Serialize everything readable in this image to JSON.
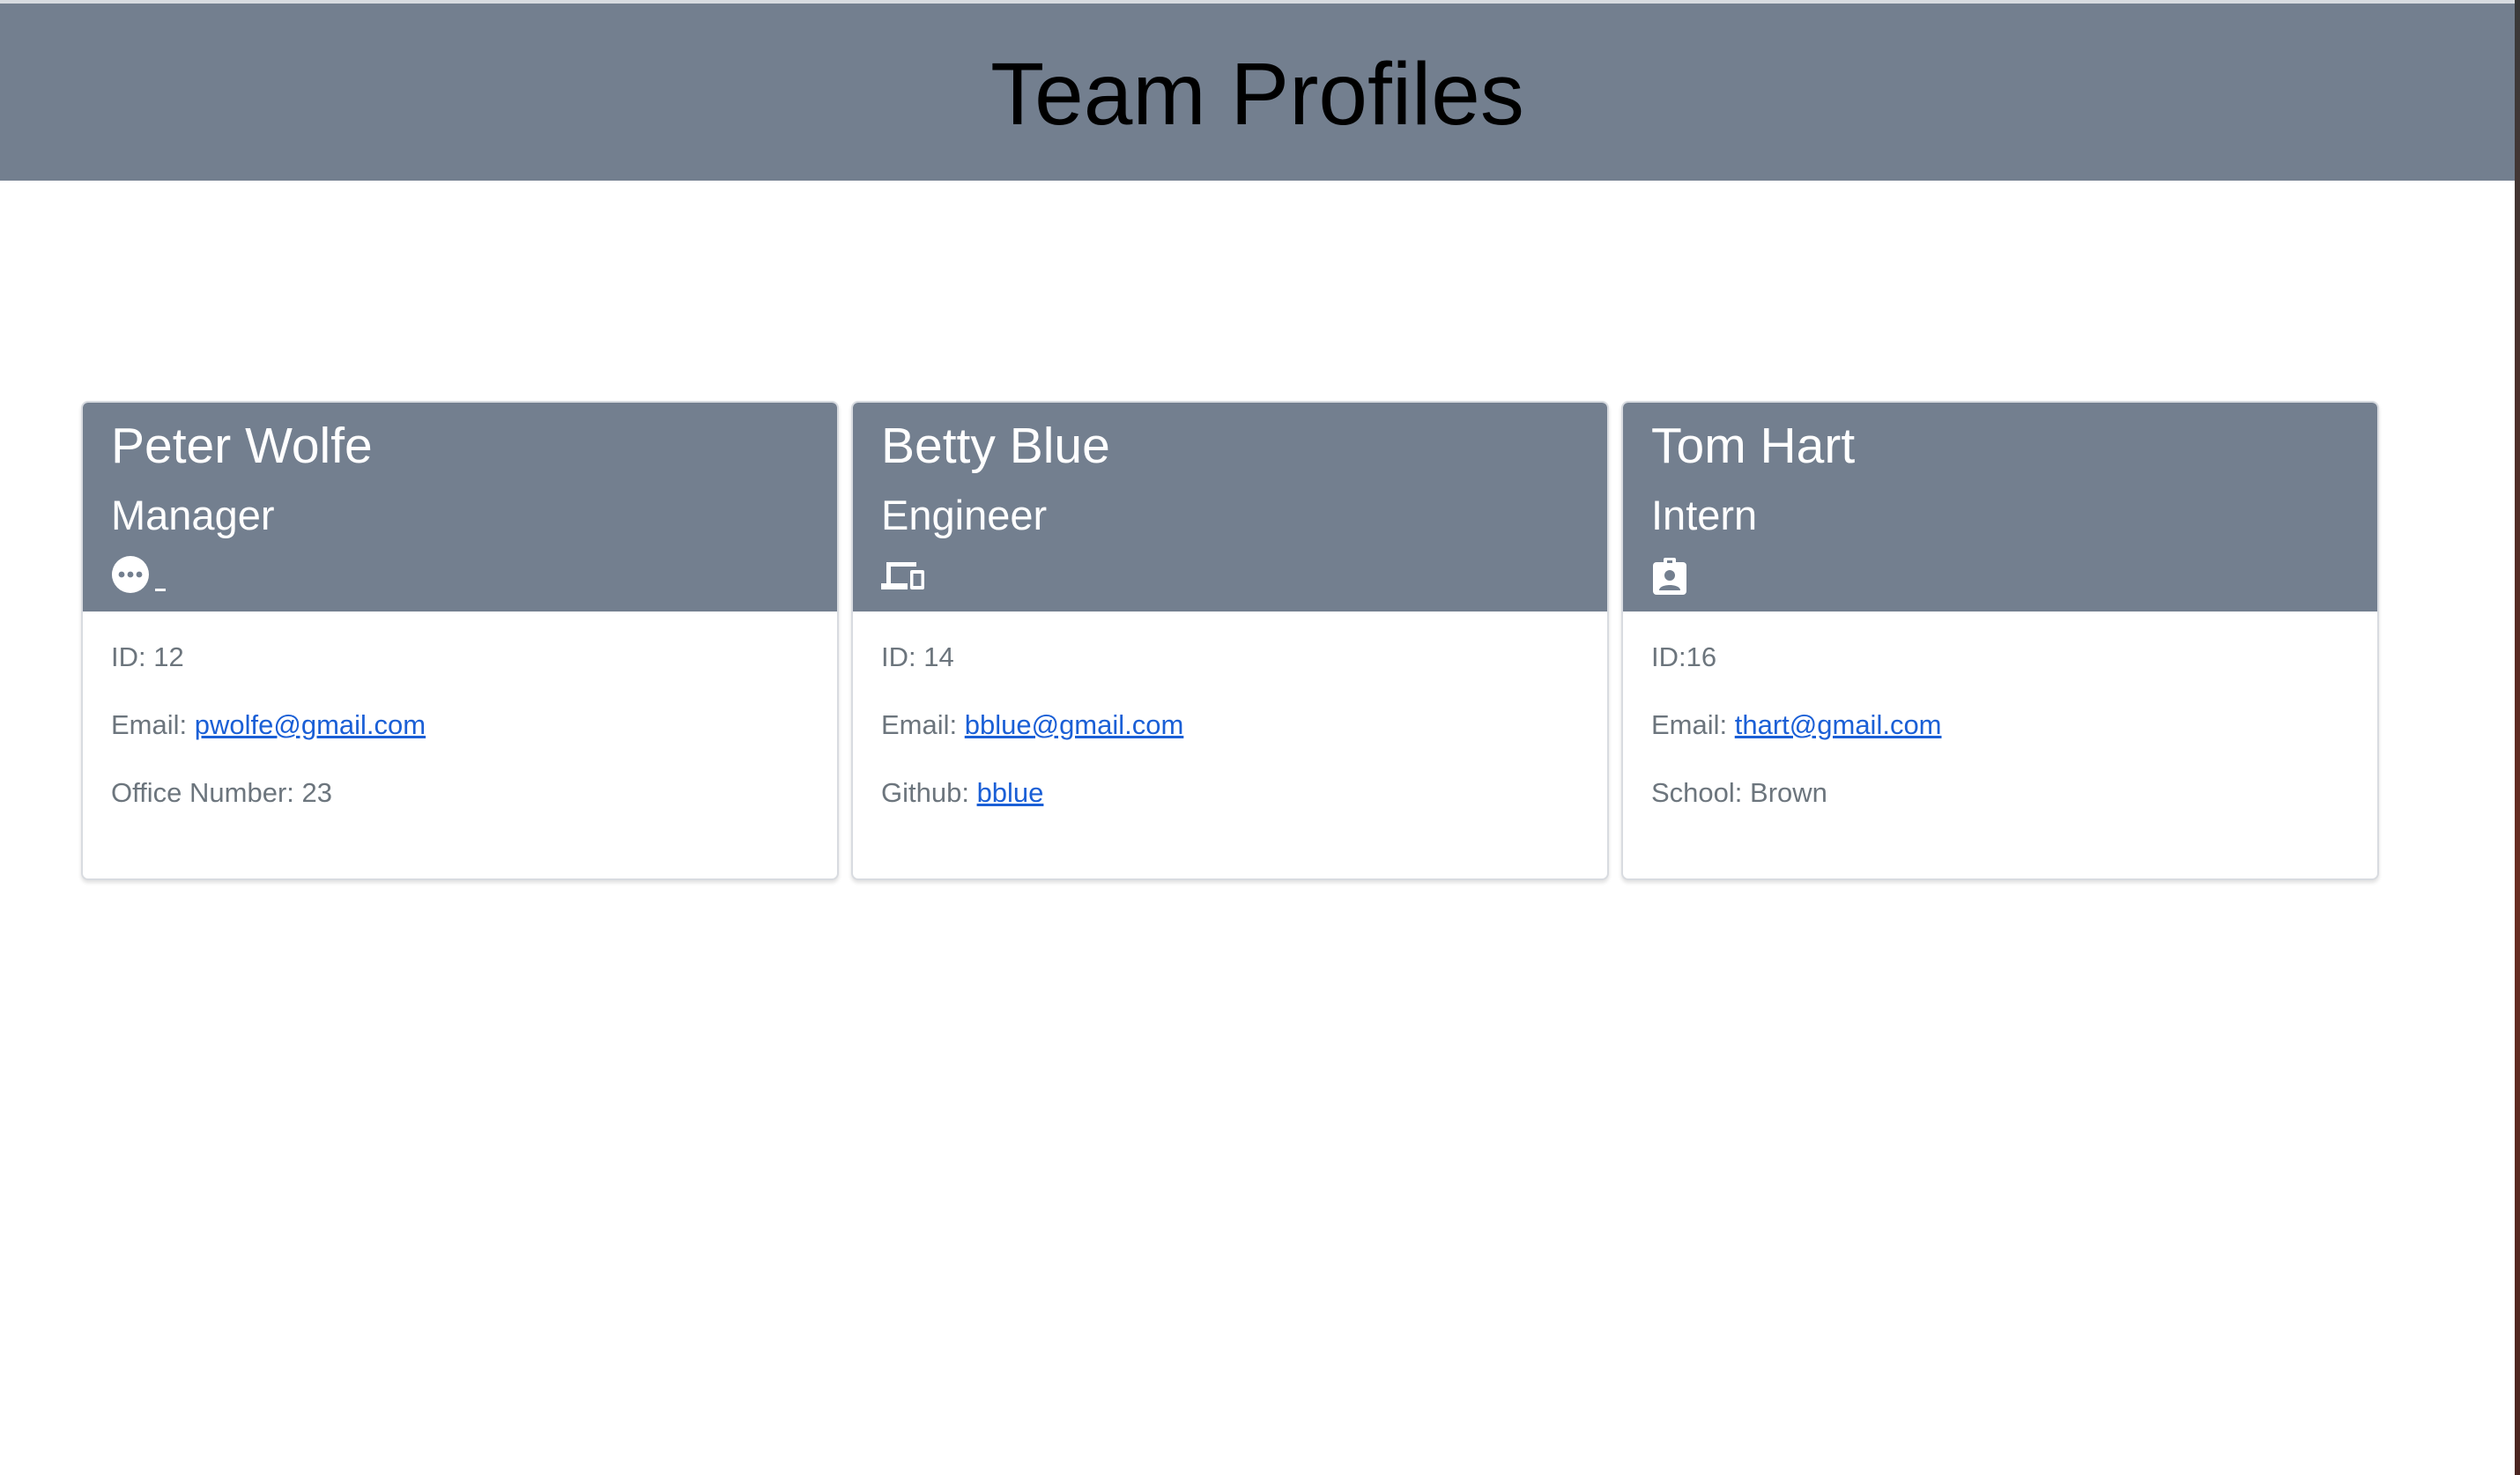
{
  "page": {
    "title": "Team Profiles"
  },
  "colors": {
    "header_bg": "#737f8f",
    "card_text": "#6c757d",
    "link": "#1a5fd6"
  },
  "cards": [
    {
      "name": "Peter Wolfe",
      "role": "Manager",
      "icon": "coffee-mug-icon",
      "id_text": "ID: 12",
      "email_label": "Email: ",
      "email": "pwolfe@gmail.com",
      "extra_label": "Office Number: ",
      "extra_value": "23"
    },
    {
      "name": "Betty Blue",
      "role": "Engineer",
      "icon": "devices-icon",
      "id_text": "ID: 14",
      "email_label": "Email: ",
      "email": "bblue@gmail.com",
      "extra_label": "Github: ",
      "extra_value": "bblue"
    },
    {
      "name": "Tom Hart",
      "role": "Intern",
      "icon": "id-badge-icon",
      "id_text": "ID:16",
      "email_label": "Email: ",
      "email": "thart@gmail.com",
      "extra_label": "School: ",
      "extra_value": "Brown"
    }
  ]
}
